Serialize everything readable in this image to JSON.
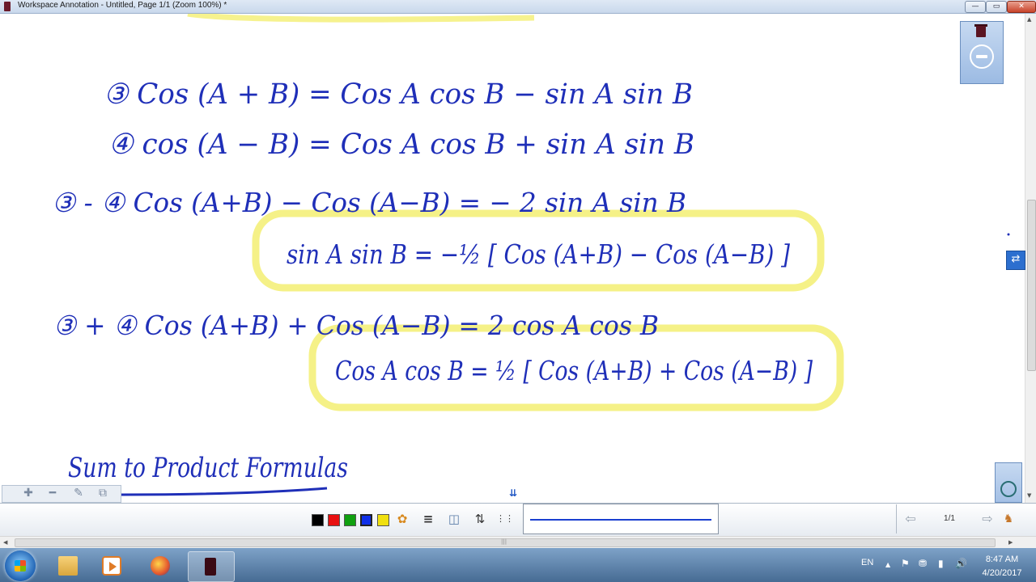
{
  "window": {
    "title": "Workspace Annotation - Untitled, Page 1/1  (Zoom 100%) *",
    "minimize_glyph": "—",
    "maximize_glyph": "▭",
    "close_glyph": "✕"
  },
  "notes": {
    "lines": [
      "③  Cos (A + B) =  Cos A cos B  −  sin A sin B",
      "④  cos (A − B) =  Cos A cos B  +  sin A sin B",
      "③ - ④     Cos (A+B) − Cos (A−B) = − 2 sin A sin B",
      "sin A sin B = −½ [ Cos (A+B) − Cos (A−B) ]",
      "③ + ④     Cos (A+B) + Cos (A−B) = 2 cos A cos B",
      "Cos A cos B = ½ [ Cos (A+B) + Cos (A−B) ]",
      "Sum to Product Formulas"
    ],
    "highlight_color": "#f4f07a",
    "ink_color": "#1f2fb8"
  },
  "mini_toolbar": {
    "plus": "✚",
    "minus": "━",
    "edit": "✎",
    "copy": "⧉"
  },
  "page_down_glyph": "⇊",
  "side_tab_glyph": "⇄",
  "toolbar": {
    "colors": [
      "#000000",
      "#e81010",
      "#10a010",
      "#1030e8",
      "#f0e010"
    ],
    "palette_glyph": "✿",
    "tool_lines": "≡",
    "tool_eraser": "◫",
    "tool_spacing": "⇅",
    "tool_grid": "⋮⋮",
    "prev_glyph": "⇦",
    "next_glyph": "⇨",
    "person_glyph": "♞",
    "page_indicator": "1/1"
  },
  "taskbar": {
    "language": "EN",
    "tray_icons": [
      "▲",
      "⚑",
      "⛃",
      "▮",
      "🔊"
    ],
    "time": "8:47 AM",
    "date": "4/20/2017"
  }
}
